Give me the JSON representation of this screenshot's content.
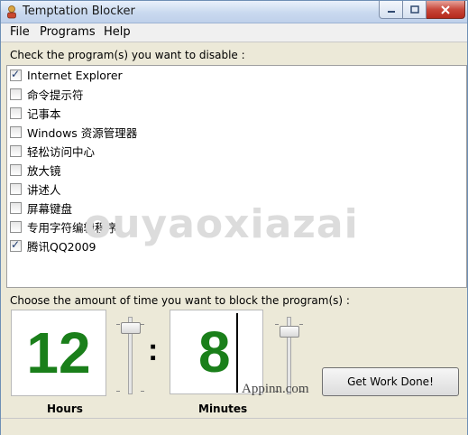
{
  "window": {
    "title": "Temptation Blocker"
  },
  "menu": {
    "items": [
      "File",
      "Programs",
      "Help"
    ]
  },
  "programs": {
    "label": "Check the program(s) you want to disable :",
    "items": [
      {
        "label": "Internet Explorer",
        "checked": true
      },
      {
        "label": "命令提示符",
        "checked": false
      },
      {
        "label": "记事本",
        "checked": false
      },
      {
        "label": "Windows 资源管理器",
        "checked": false
      },
      {
        "label": "轻松访问中心",
        "checked": false
      },
      {
        "label": "放大镜",
        "checked": false
      },
      {
        "label": "讲述人",
        "checked": false
      },
      {
        "label": "屏幕键盘",
        "checked": false
      },
      {
        "label": "专用字符编辑程序",
        "checked": false
      },
      {
        "label": "腾讯QQ2009",
        "checked": true
      }
    ]
  },
  "watermark": "ouyaoxiazai",
  "timer": {
    "label": "Choose the amount of time you want to block the program(s) :",
    "hours_value": "12",
    "minutes_value": "8",
    "colon": ":",
    "hours_label": "Hours",
    "minutes_label": "Minutes"
  },
  "button": {
    "label": "Get Work Done!"
  },
  "site_watermark": "Appinn.com",
  "colors": {
    "digit": "#1a7f1a",
    "title_bar": "#c9d9ef"
  }
}
